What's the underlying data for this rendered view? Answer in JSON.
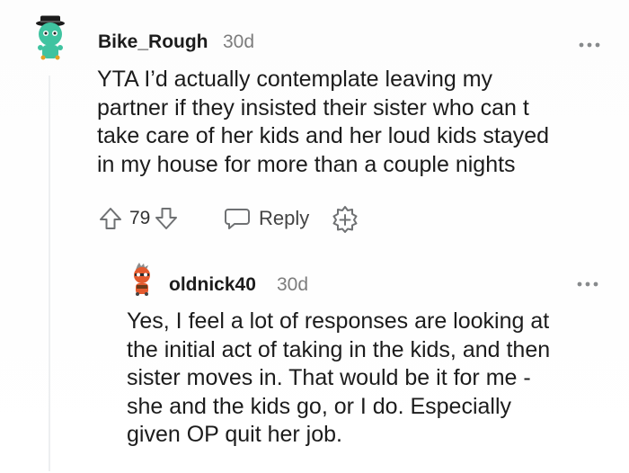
{
  "thread": {
    "comment": {
      "username": "Bike_Rough",
      "age": "30d",
      "body_lines": [
        "YTA I’d actually contemplate leaving my",
        "partner if they insisted their sister who can t",
        "take care of her kids and her loud kids stayed",
        "in my house for more than a couple nights"
      ],
      "score": "79",
      "reply_label": "Reply",
      "icons": {
        "avatar": "snoo-avatar-green",
        "more": "more-options-icon",
        "upvote": "upvote-arrow-icon",
        "downvote": "downvote-arrow-icon",
        "reply": "speech-bubble-icon",
        "award": "award-plus-icon"
      }
    },
    "reply": {
      "username": "oldnick40",
      "age": "30d",
      "body_lines": [
        "Yes, I feel a lot of responses are looking at",
        "the initial act of taking in the kids, and then",
        "sister moves in. That would be it for me -",
        "she and the kids go, or I do. Especially",
        "given OP quit her job."
      ],
      "icons": {
        "avatar": "snoo-avatar-orange",
        "more": "more-options-icon"
      }
    }
  },
  "colors": {
    "text_primary": "#1c1c1c",
    "text_secondary": "#7c7c7c",
    "thread_line": "#edeff1",
    "avatar_green": "#3fc3a0",
    "avatar_orange": "#e35a2e"
  }
}
